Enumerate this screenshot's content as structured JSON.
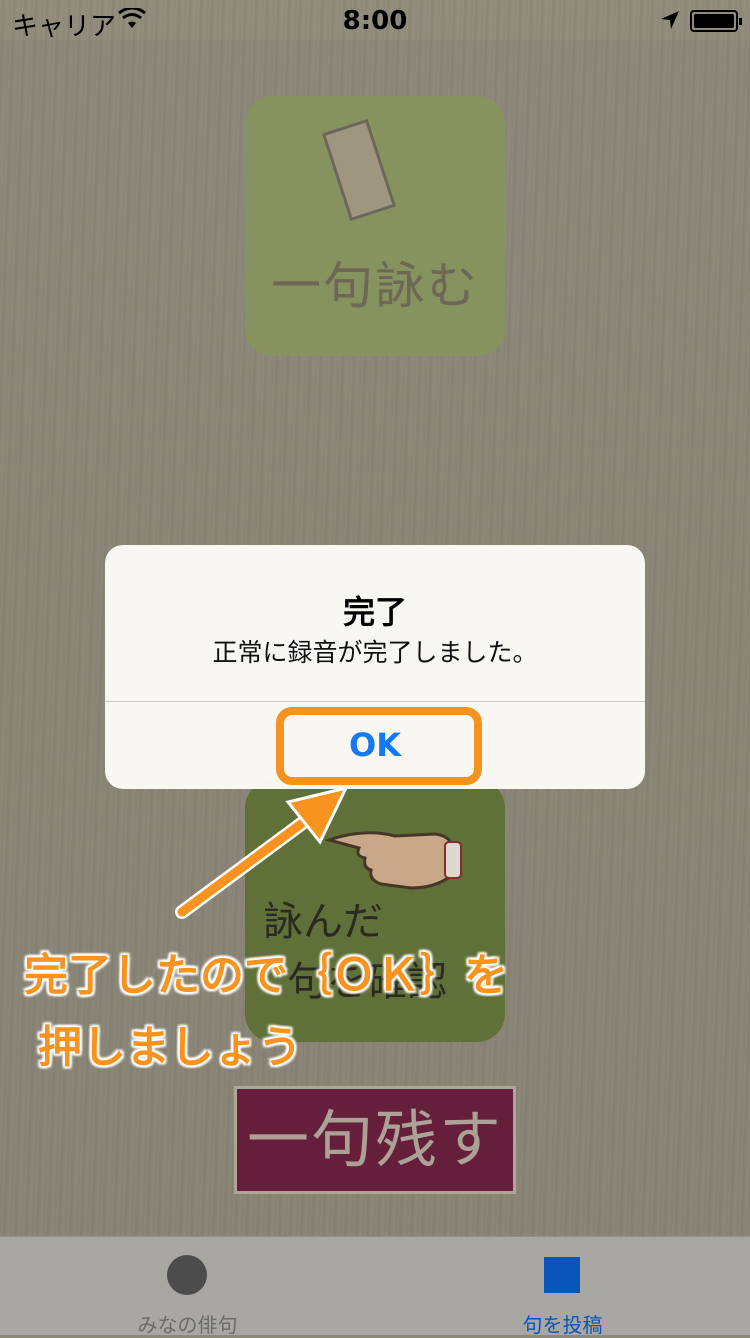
{
  "status_bar": {
    "carrier": "キャリア",
    "time": "8:00"
  },
  "home": {
    "yomu_tile_label": "一句詠む",
    "kakunin_tile_line1": "詠んだ",
    "kakunin_tile_line2": "句を確認",
    "nokosu_button": "一句残す"
  },
  "alert": {
    "title": "完了",
    "message": "正常に録音が完了しました。",
    "ok_button": "OK"
  },
  "annotation": {
    "line1": "完了したので｛ＯＫ｝を",
    "line2": "押しましょう",
    "highlight_color": "#f6921e"
  },
  "tab_bar": {
    "tabs": [
      {
        "label": "みなの俳句",
        "icon": "circle-icon",
        "selected": false
      },
      {
        "label": "句を投稿",
        "icon": "square-icon",
        "selected": true
      }
    ]
  }
}
